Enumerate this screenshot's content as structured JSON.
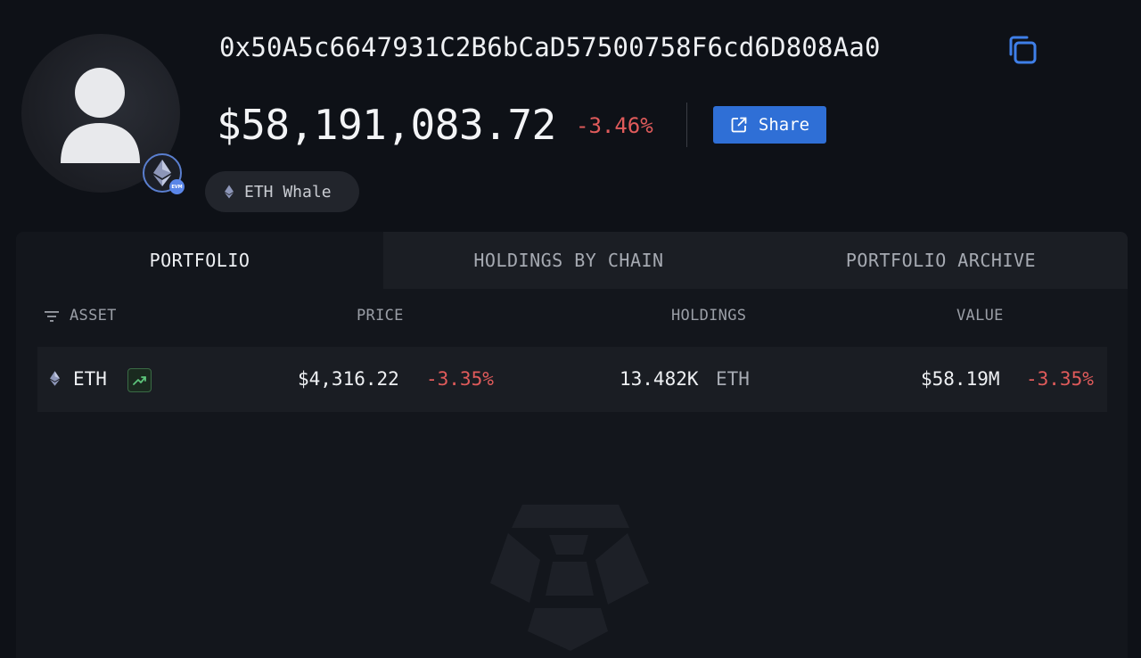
{
  "profile": {
    "address": "0x50A5c6647931C2B6bCaD57500758F6cd6D808Aa0",
    "balance": "$58,191,083.72",
    "balance_change": "-3.46%",
    "share_label": "Share",
    "tag": "ETH Whale",
    "chain_badge": "EVM"
  },
  "tabs": [
    {
      "label": "PORTFOLIO",
      "active": true
    },
    {
      "label": "HOLDINGS BY CHAIN",
      "active": false
    },
    {
      "label": "PORTFOLIO ARCHIVE",
      "active": false
    }
  ],
  "table": {
    "headers": {
      "asset": "ASSET",
      "price": "PRICE",
      "holdings": "HOLDINGS",
      "value": "VALUE"
    },
    "rows": [
      {
        "asset": "ETH",
        "price": "$4,316.22",
        "price_change": "-3.35%",
        "holdings": "13.482K",
        "holdings_unit": "ETH",
        "value": "$58.19M",
        "value_change": "-3.35%"
      }
    ]
  },
  "colors": {
    "background": "#0e1117",
    "accent": "#2f6fd6",
    "negative": "#e05b5b",
    "positive": "#4caf6a"
  }
}
